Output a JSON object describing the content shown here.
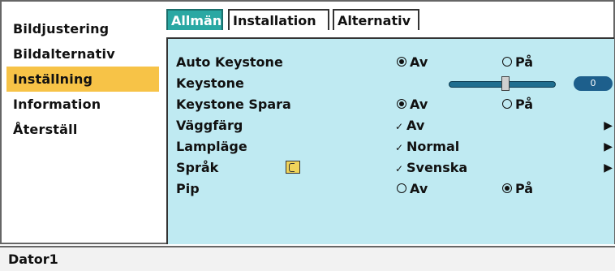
{
  "sidebar": {
    "items": [
      {
        "label": "Bildjustering"
      },
      {
        "label": "Bildalternativ"
      },
      {
        "label": "Inställning"
      },
      {
        "label": "Information"
      },
      {
        "label": "Återställ"
      }
    ],
    "active_index": 2
  },
  "tabs": [
    {
      "label": "Allmän"
    },
    {
      "label": "Installation"
    },
    {
      "label": "Alternativ"
    }
  ],
  "settings": {
    "auto_keystone": {
      "label": "Auto Keystone",
      "opt1": "Av",
      "opt2": "På",
      "selected": "Av"
    },
    "keystone": {
      "label": "Keystone",
      "value": "0"
    },
    "keystone_spara": {
      "label": "Keystone Spara",
      "opt1": "Av",
      "opt2": "På",
      "selected": "Av"
    },
    "vaggfarg": {
      "label": "Väggfärg",
      "value": "Av"
    },
    "lamplage": {
      "label": "Lampläge",
      "value": "Normal"
    },
    "sprak": {
      "label": "Språk",
      "value": "Svenska"
    },
    "pip": {
      "label": "Pip",
      "opt1": "Av",
      "opt2": "På",
      "selected": "På"
    }
  },
  "status": {
    "source": "Dator1"
  },
  "colors": {
    "active_tab": "#2aa8a3",
    "active_sidebar": "#f7c347",
    "panel_bg": "#bfeaf2"
  }
}
